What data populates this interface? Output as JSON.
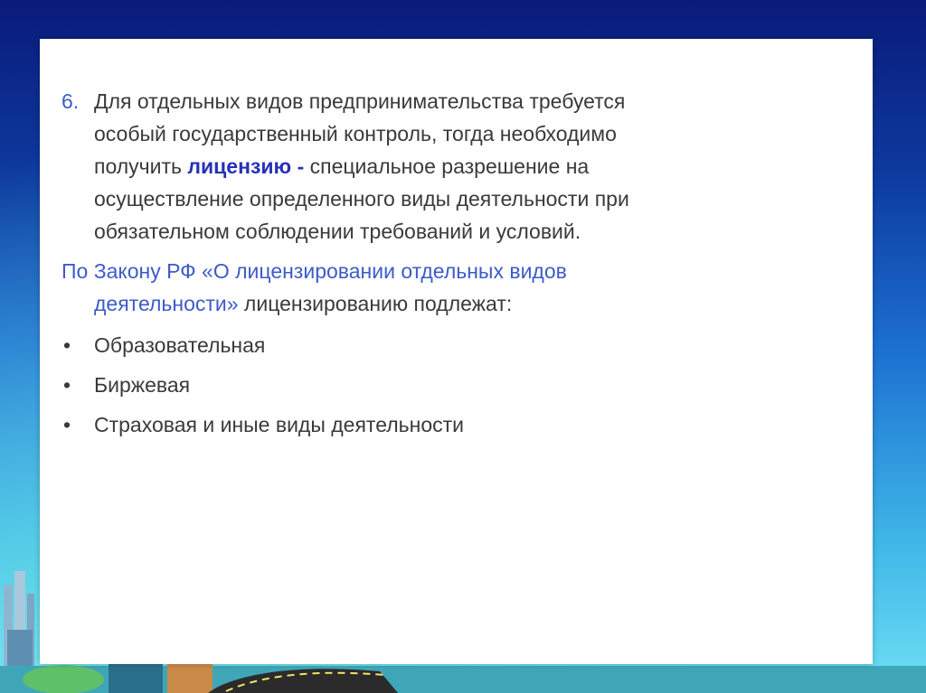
{
  "paragraph1": {
    "number": "6.",
    "line1": "Для отдельных видов предпринимательства требуется",
    "line2": "особый государственный контроль, тогда необходимо",
    "line3_pre": "получить ",
    "line3_hl": "лицензию -",
    "line3_post": " специальное разрешение на",
    "line4": "осуществление определенного виды деятельности при",
    "line5": "обязательном соблюдении требований и условий."
  },
  "law": {
    "line1": "По Закону РФ «О лицензировании отдельных видов",
    "line2_blue": "деятельности»",
    "line2_rest": " лицензированию подлежат:"
  },
  "list": {
    "bullet": "•",
    "items": [
      "Образовательная",
      "Биржевая",
      "Страховая и иные виды деятельности"
    ]
  },
  "colors": {
    "accent": "#3d5bc9",
    "highlight": "#2432b8",
    "text": "#3a3a3a"
  }
}
